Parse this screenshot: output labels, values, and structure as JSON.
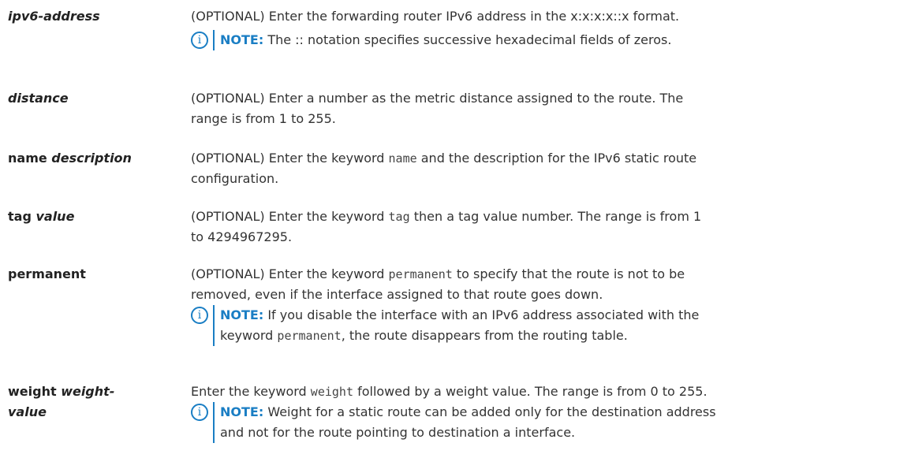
{
  "rows": [
    {
      "param_plain": "",
      "param_italic": "ipv6-address",
      "desc_lines": [
        "(OPTIONAL) Enter the forwarding router IPv6 address in the x:x:x:x::x format."
      ],
      "note": {
        "label": "NOTE:",
        "lines": [
          " The :: notation specifies successive hexadecimal fields of zeros."
        ]
      }
    },
    {
      "param_plain": "",
      "param_italic": "distance",
      "desc_lines": [
        "(OPTIONAL) Enter a number as the metric distance assigned to the route. The",
        "range is from 1 to 255."
      ]
    },
    {
      "param_plain": "name ",
      "param_italic": "description",
      "desc_parts": [
        "(OPTIONAL) Enter the keyword ",
        "name",
        " and the description for the IPv6 static route"
      ],
      "desc_line2": "configuration."
    },
    {
      "param_plain": "tag ",
      "param_italic": "value",
      "desc_parts": [
        "(OPTIONAL) Enter the keyword ",
        "tag",
        " then a tag value number. The range is from 1"
      ],
      "desc_line2": "to 4294967295."
    },
    {
      "param_plain": "permanent",
      "param_italic": "",
      "desc_parts": [
        "(OPTIONAL) Enter the keyword ",
        "permanent",
        " to specify that the route is not to be"
      ],
      "desc_line2": "removed, even if the interface assigned to that route goes down.",
      "note": {
        "label": "NOTE:",
        "line1": " If you disable the interface with an IPv6 address associated with the",
        "line2_pre": "keyword ",
        "line2_code": "permanent",
        "line2_post": ", the route disappears from the routing table."
      }
    },
    {
      "param_plain": "weight ",
      "param_italic": "weight-",
      "param_italic_line2": "value",
      "desc_parts": [
        "Enter the keyword ",
        "weight",
        " followed by a weight value. The range is from 0 to 255."
      ],
      "note": {
        "label": "NOTE:",
        "line1": " Weight for a static route can be added only for the destination address",
        "line2": "and not for the route pointing to destination a interface."
      }
    }
  ]
}
